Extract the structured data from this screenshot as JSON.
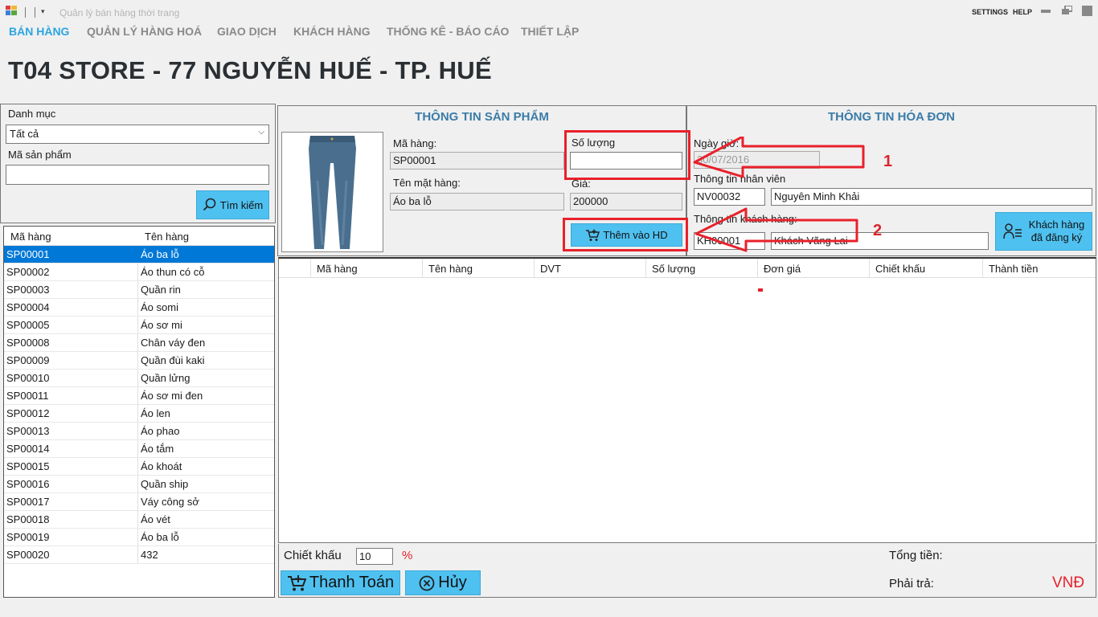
{
  "window": {
    "title": "Quản lý bán hàng thời trang",
    "settings": "SETTINGS",
    "help": "HELP",
    "quick_access_dropdown": "▾"
  },
  "menu": [
    "BÁN HÀNG",
    "QUẢN LÝ HÀNG HOÁ",
    "GIAO DỊCH",
    "KHÁCH HÀNG",
    "THỐNG KÊ - BÁO CÁO",
    "THIẾT LẬP"
  ],
  "store_title": "T04 STORE - 77 NGUYỄN HUẾ - TP. HUẾ",
  "filter": {
    "category_label": "Danh mục",
    "category_value": "Tất cả",
    "code_label": "Mã sản phẩm",
    "code_value": "",
    "search_button": "Tìm kiếm"
  },
  "product_list": {
    "columns": [
      "Mã hàng",
      "Tên hàng"
    ],
    "selected_index": 0,
    "rows": [
      [
        "SP00001",
        "Áo ba lỗ"
      ],
      [
        "SP00002",
        "Áo thun có cỗ"
      ],
      [
        "SP00003",
        "Quần rin"
      ],
      [
        "SP00004",
        "Áo somi"
      ],
      [
        "SP00005",
        "Áo sơ mi"
      ],
      [
        "SP00008",
        "Chân váy đen"
      ],
      [
        "SP00009",
        "Quần đùi kaki"
      ],
      [
        "SP00010",
        "Quần lửng"
      ],
      [
        "SP00011",
        "Áo sơ mi đen"
      ],
      [
        "SP00012",
        "Áo len"
      ],
      [
        "SP00013",
        "Áo phao"
      ],
      [
        "SP00014",
        "Áo tắm"
      ],
      [
        "SP00015",
        "Áo khoát"
      ],
      [
        "SP00016",
        "Quần ship"
      ],
      [
        "SP00017",
        "Váy công sở"
      ],
      [
        "SP00018",
        "Áo vét"
      ],
      [
        "SP00019",
        "Áo ba lỗ"
      ],
      [
        "SP00020",
        "432"
      ]
    ]
  },
  "product_info": {
    "header": "THÔNG TIN SẢN PHẨM",
    "code_label": "Mã hàng:",
    "code_value": "SP00001",
    "name_label": "Tên mặt hàng:",
    "name_value": "Áo ba lỗ",
    "qty_label": "Số lượng",
    "qty_value": "",
    "price_label": "Giá:",
    "price_value": "200000",
    "add_button": "Thêm vào HD"
  },
  "invoice_info": {
    "header": "THÔNG TIN HÓA ĐƠN",
    "datetime_label": "Ngày giờ:",
    "datetime_value": "30/07/2016",
    "employee_label": "Thông tin nhân viên",
    "employee_id": "NV00032",
    "employee_name": "Nguyên Minh Khải",
    "customer_label": "Thông tin khách hàng:",
    "customer_id": "KH00001",
    "customer_name": "Khách Vãng Lai",
    "registered_button_line1": "Khách hàng",
    "registered_button_line2": "đã đăng ký"
  },
  "invoice_grid": {
    "columns": [
      "",
      "Mã hàng",
      "Tên hàng",
      "DVT",
      "Số lượng",
      "Đơn giá",
      "Chiết khấu",
      "Thành tiền"
    ]
  },
  "footer": {
    "discount_label": "Chiết khấu",
    "discount_value": "10",
    "percent": "%",
    "pay_button": "Thanh Toán",
    "cancel_button": "Hủy",
    "total_label": "Tổng tiền:",
    "total_value": "",
    "payable_label": "Phải trả:",
    "currency": "VNĐ"
  },
  "annotations": {
    "arrow_1": "1",
    "arrow_2": "2",
    "color": "#e8212b"
  }
}
